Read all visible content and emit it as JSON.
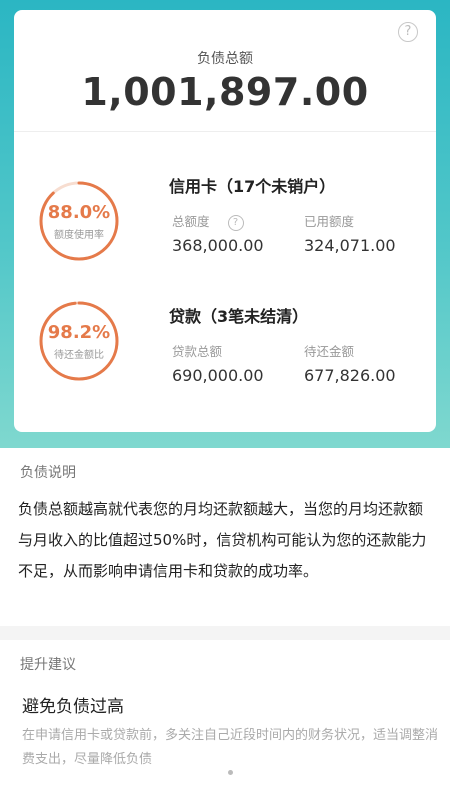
{
  "summary": {
    "total_label": "负债总额",
    "total_value": "1,001,897.00",
    "help_glyph": "?"
  },
  "credit_card": {
    "title": "信用卡（17个未销户）",
    "ring_percent_text": "88.0%",
    "ring_fraction": 0.88,
    "ring_caption": "额度使用率",
    "col1_label": "总额度",
    "col1_value": "368,000.00",
    "col2_label": "已用额度",
    "col2_value": "324,071.00"
  },
  "loan": {
    "title": "贷款（3笔未结清）",
    "ring_percent_text": "98.2%",
    "ring_fraction": 0.982,
    "ring_caption": "待还金额比",
    "col1_label": "贷款总额",
    "col1_value": "690,000.00",
    "col2_label": "待还金额",
    "col2_value": "677,826.00"
  },
  "explanation": {
    "heading": "负债说明",
    "text": "负债总额越高就代表您的月均还款额越大，当您的月均还款额与月收入的比值超过50%时，信贷机构可能认为您的还款能力不足，从而影响申请信用卡和贷款的成功率。"
  },
  "advice": {
    "heading": "提升建议",
    "title": "避免负债过高",
    "text": "在申请信用卡或贷款前，多关注自己近段时间内的财务状况，适当调整消费支出，尽量降低负债"
  },
  "colors": {
    "accent": "#e57a4a",
    "ring_track": "#f7ddd0",
    "hero_top": "#2bb6c3",
    "hero_bottom": "#7fd8cf"
  }
}
